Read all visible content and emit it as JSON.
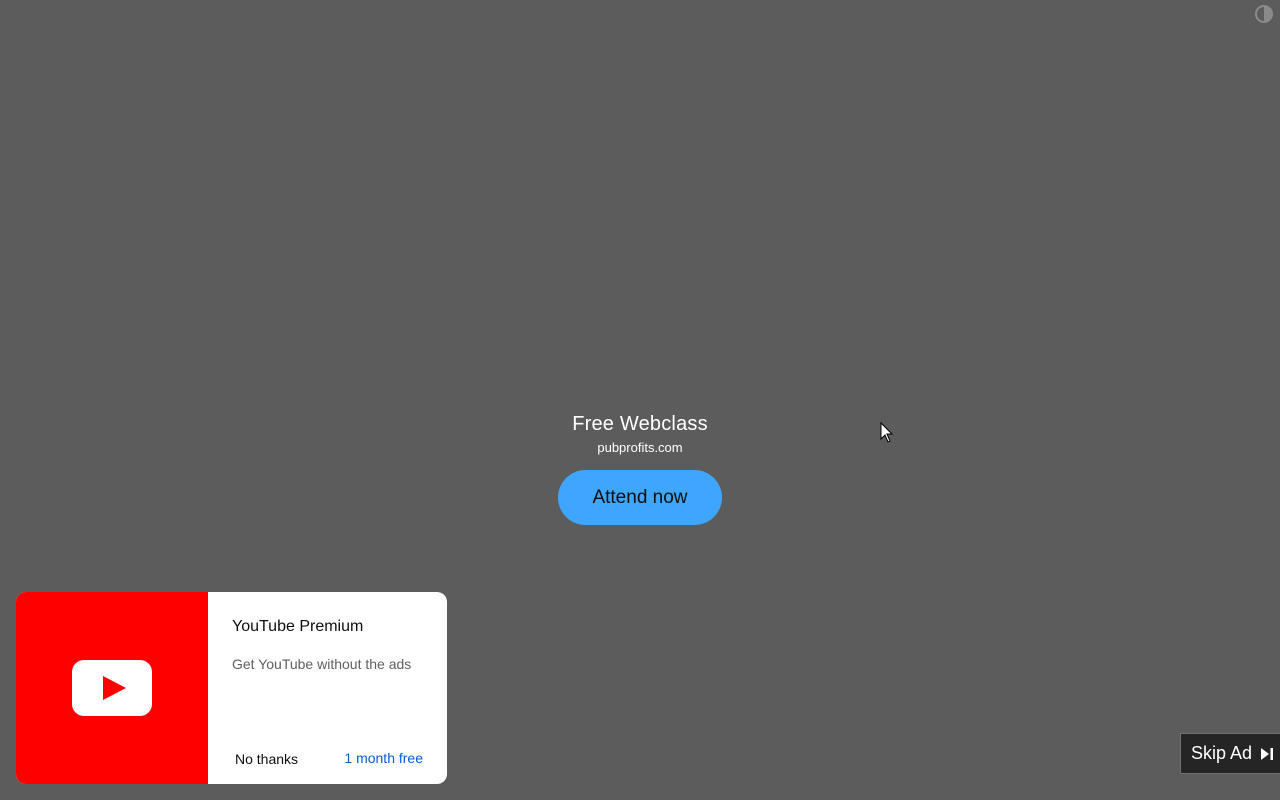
{
  "ad": {
    "title": "Free Webclass",
    "domain": "pubprofits.com",
    "cta_label": "Attend now"
  },
  "premium_card": {
    "title": "YouTube Premium",
    "subtitle": "Get YouTube without the ads",
    "dismiss_label": "No thanks",
    "offer_label": "1 month free",
    "logo_icon": "youtube-play-icon",
    "brand_color": "#ff0000",
    "link_color": "#065fd4"
  },
  "skip_ad": {
    "label": "Skip Ad",
    "icon": "skip-next-icon"
  },
  "colors": {
    "background": "#5c5c5c",
    "cta_background": "#3ea6ff"
  }
}
